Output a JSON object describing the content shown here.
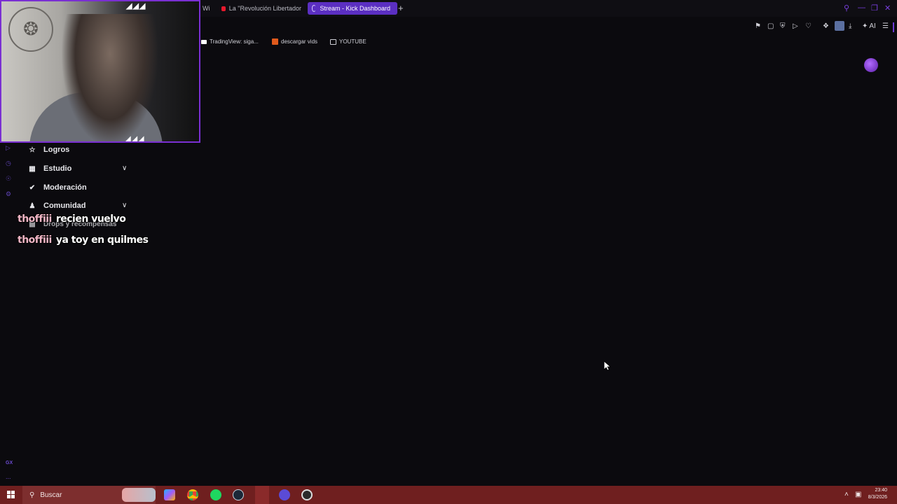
{
  "browser": {
    "tabs": [
      {
        "label": "Wi",
        "active": false
      },
      {
        "label": "La \"Revolución Libertador",
        "active": false,
        "icon": "youtube-icon"
      },
      {
        "label": "Stream - Kick Dashboard",
        "active": true,
        "icon": "loading-spinner-icon"
      }
    ],
    "new_tab_glyph": "+",
    "bookmarks": [
      {
        "label": "TradingView: siga...",
        "icon": "tradingview-icon"
      },
      {
        "label": "descargar vids",
        "icon": "play-icon"
      },
      {
        "label": "YOUTUBE",
        "icon": "folder-icon"
      }
    ],
    "toolbar_ai_label": "AI",
    "accent_color": "#5b2fc2"
  },
  "sidebar": {
    "items": [
      {
        "label": "Logros",
        "icon": "trophy-icon",
        "expandable": false
      },
      {
        "label": "Estudio",
        "icon": "studio-icon",
        "expandable": true
      },
      {
        "label": "Moderación",
        "icon": "wrench-icon",
        "expandable": false
      },
      {
        "label": "Comunidad",
        "icon": "community-icon",
        "expandable": true
      },
      {
        "label": "Drops y recompensas",
        "icon": "gift-icon",
        "expandable": false
      }
    ],
    "gx_label": "GX",
    "more_label": "..."
  },
  "chat": [
    {
      "user": "thoffiii",
      "message": "recien vuelvo"
    },
    {
      "user": "thoffiii",
      "message": "ya toy en quilmes"
    }
  ],
  "taskbar": {
    "search_placeholder": "Buscar",
    "time": "23:40",
    "date": "8/3/2026",
    "background_color": "#6f1f1f"
  }
}
